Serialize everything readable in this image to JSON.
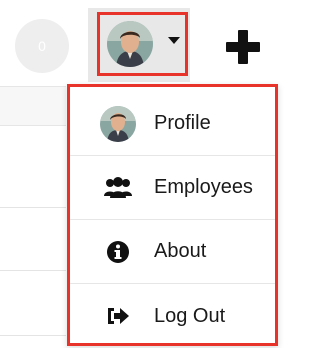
{
  "header": {
    "notification_count": "0",
    "user_menu_toggle_icon": "avatar-icon",
    "create_icon": "plus-icon"
  },
  "menu": {
    "items": [
      {
        "label": "Profile",
        "icon": "avatar-icon"
      },
      {
        "label": "Employees",
        "icon": "users-icon"
      },
      {
        "label": "About",
        "icon": "info-circle-icon"
      },
      {
        "label": "Log Out",
        "icon": "sign-out-icon"
      }
    ]
  },
  "colors": {
    "highlight": "#e8332a",
    "icon": "#111111"
  }
}
